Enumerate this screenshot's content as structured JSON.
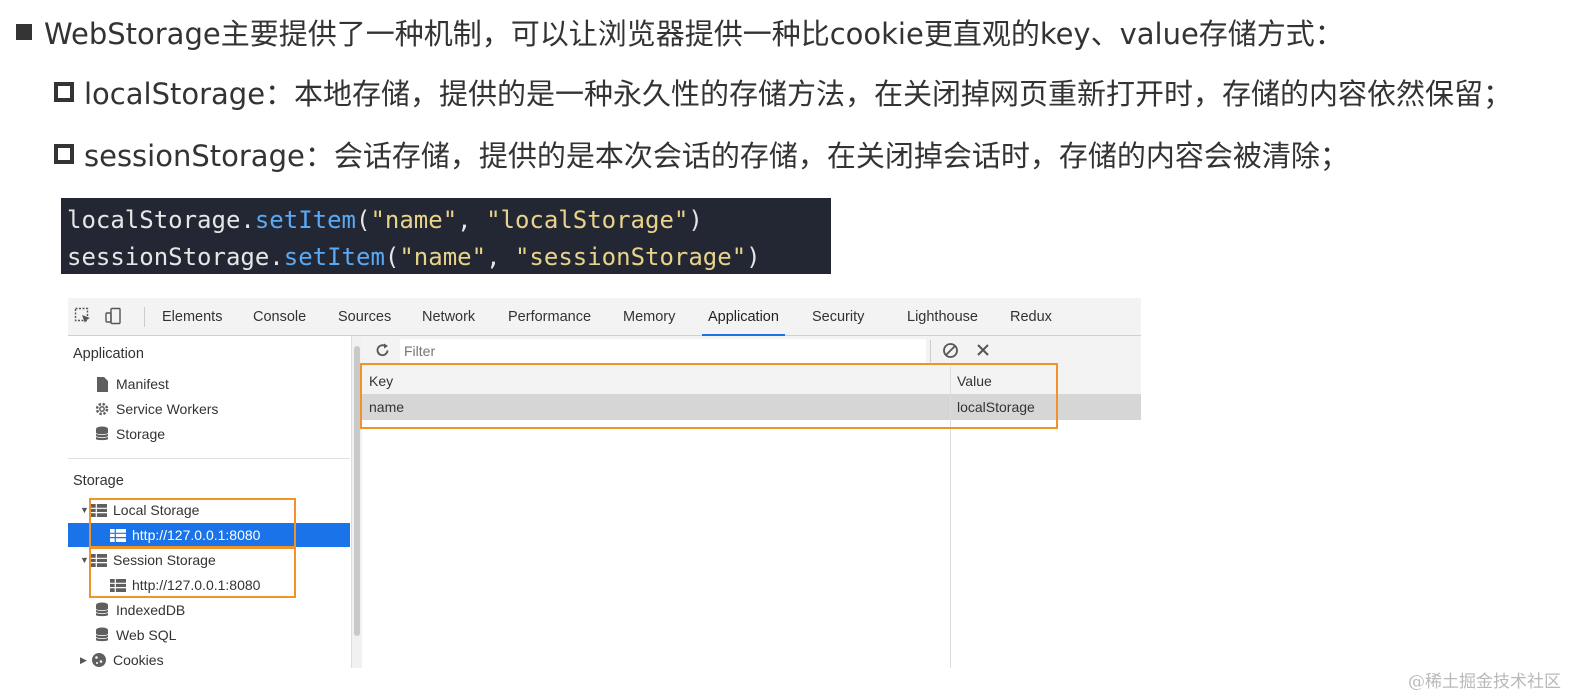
{
  "intro": {
    "main_text": "WebStorage主要提供了一种机制，可以让浏览器提供一种比cookie更直观的key、value存储方式：",
    "local_text": "localStorage：本地存储，提供的是一种永久性的存储方法，在关闭掉网页重新打开时，存储的内容依然保留；",
    "session_text": "sessionStorage：会话存储，提供的是本次会话的存储，在关闭掉会话时，存储的内容会被清除；"
  },
  "code": {
    "line1": {
      "obj": "localStorage",
      "dot": ".",
      "method": "setItem",
      "open": "(",
      "arg1": "\"name\"",
      "comma": ", ",
      "arg2": "\"localStorage\"",
      "close": ")"
    },
    "line2": {
      "obj": "sessionStorage",
      "dot": ".",
      "method": "setItem",
      "open": "(",
      "arg1": "\"name\"",
      "comma": ", ",
      "arg2": "\"sessionStorage\"",
      "close": ")"
    }
  },
  "devtools": {
    "tabs": [
      "Elements",
      "Console",
      "Sources",
      "Network",
      "Performance",
      "Memory",
      "Application",
      "Security",
      "Lighthouse",
      "Redux"
    ],
    "active_tab": "Application",
    "accent_color": "#1a73e8",
    "highlight_color": "#f0932b",
    "sidebar": {
      "application_title": "Application",
      "application_items": [
        {
          "label": "Manifest",
          "icon": "file-icon"
        },
        {
          "label": "Service Workers",
          "icon": "gear-icon"
        },
        {
          "label": "Storage",
          "icon": "database-icon"
        }
      ],
      "storage_title": "Storage",
      "local_storage": {
        "label": "Local Storage",
        "origin": "http://127.0.0.1:8080"
      },
      "session_storage": {
        "label": "Session Storage",
        "origin": "http://127.0.0.1:8080"
      },
      "other_items": [
        {
          "label": "IndexedDB",
          "icon": "database-icon"
        },
        {
          "label": "Web SQL",
          "icon": "database-icon"
        },
        {
          "label": "Cookies",
          "icon": "cookie-icon"
        }
      ]
    },
    "filter": {
      "placeholder": "Filter"
    },
    "table": {
      "headers": {
        "key": "Key",
        "value": "Value"
      },
      "rows": [
        {
          "key": "name",
          "value": "localStorage"
        }
      ]
    }
  },
  "watermark": "@稀土掘金技术社区"
}
